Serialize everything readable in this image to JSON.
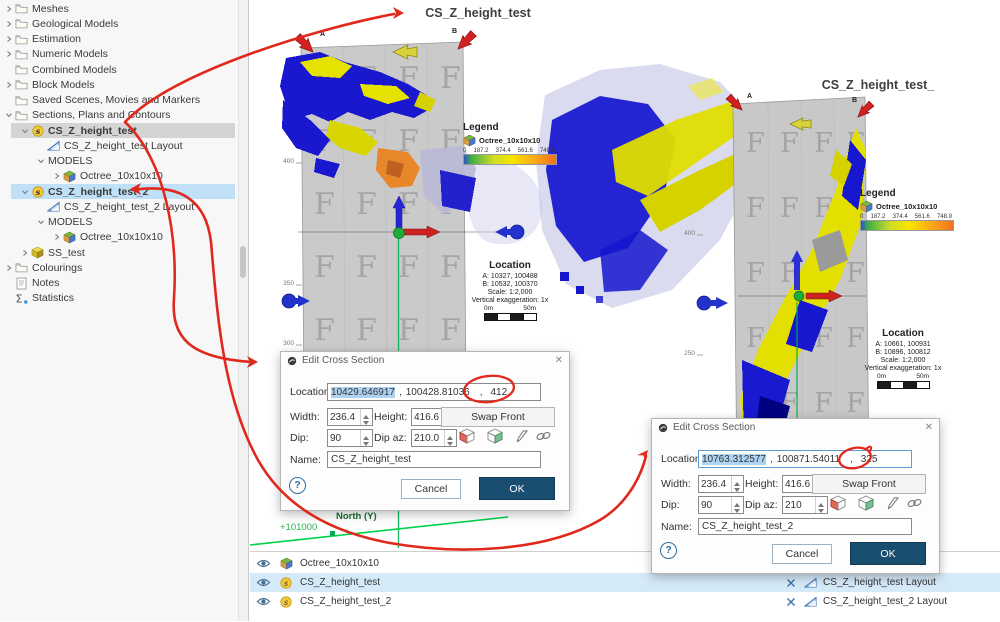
{
  "colors": {
    "accent-blue": "#2d6da3",
    "ok-button": "#1a4e71",
    "selection-blue": "#bfe0f7",
    "selection-gray": "#d4d4d4",
    "row-highlight": "#d5eaf9",
    "text-select": "#aed3f2",
    "annotation-red": "#e0281c",
    "voxel-blue": "#1a18cf",
    "voxel-yellow": "#e6e200",
    "voxel-orange": "#e8872a",
    "plane-gray": "#cacaca",
    "north-green": "#2fae52"
  },
  "sidebar": {
    "items": [
      {
        "label": "Meshes",
        "level": 0,
        "chevron": "collapsed",
        "icon": "folder"
      },
      {
        "label": "Geological Models",
        "level": 0,
        "chevron": "collapsed",
        "icon": "folder"
      },
      {
        "label": "Estimation",
        "level": 0,
        "chevron": "collapsed",
        "icon": "folder"
      },
      {
        "label": "Numeric Models",
        "level": 0,
        "chevron": "collapsed",
        "icon": "folder"
      },
      {
        "label": "Combined Models",
        "level": 0,
        "chevron": "none",
        "icon": "folder"
      },
      {
        "label": "Block Models",
        "level": 0,
        "chevron": "collapsed",
        "icon": "folder"
      },
      {
        "label": "Saved Scenes, Movies and Markers",
        "level": 0,
        "chevron": "none",
        "icon": "folder"
      },
      {
        "label": "Sections, Plans and Contours",
        "level": 0,
        "chevron": "expanded",
        "icon": "folder"
      },
      {
        "label": "CS_Z_height_test",
        "level": 1,
        "chevron": "expanded",
        "icon": "section",
        "bold": true,
        "selected": "gray"
      },
      {
        "label": "CS_Z_height_test Layout",
        "level": 2,
        "chevron": "none",
        "icon": "layout"
      },
      {
        "label": "MODELS",
        "level": 2,
        "chevron": "expanded",
        "icon": "none"
      },
      {
        "label": "Octree_10x10x10",
        "level": 3,
        "chevron": "collapsed",
        "icon": "octree"
      },
      {
        "label": "CS_Z_height_test_2",
        "level": 1,
        "chevron": "expanded",
        "icon": "section",
        "bold": true,
        "selected": "blue"
      },
      {
        "label": "CS_Z_height_test_2 Layout",
        "level": 2,
        "chevron": "none",
        "icon": "layout"
      },
      {
        "label": "MODELS",
        "level": 2,
        "chevron": "expanded",
        "icon": "none"
      },
      {
        "label": "Octree_10x10x10",
        "level": 3,
        "chevron": "collapsed",
        "icon": "octree"
      },
      {
        "label": "SS_test",
        "level": 1,
        "chevron": "collapsed",
        "icon": "cube"
      },
      {
        "label": "Colourings",
        "level": 0,
        "chevron": "collapsed",
        "icon": "folder"
      },
      {
        "label": "Notes",
        "level": 0,
        "chevron": "none",
        "icon": "notes"
      },
      {
        "label": "Statistics",
        "level": 0,
        "chevron": "none",
        "icon": "statistics"
      }
    ]
  },
  "viewport": {
    "left_view": {
      "title": "CS_Z_height_test",
      "marker_a": "A",
      "marker_b": "B",
      "legend": {
        "title": "Legend",
        "layer": "Octree_10x10x10",
        "ticks": [
          "0",
          "187.2",
          "374.4",
          "561.6",
          "748.9"
        ]
      },
      "location": {
        "title": "Location",
        "a_label": "A:",
        "a": "10327, 100488",
        "b_label": "B:",
        "b": "10532, 100370",
        "scale": "Scale: 1:2,000",
        "ve": "Vertical exaggeration: 1x",
        "d0": "0m",
        "d50": "50m"
      },
      "ruler": [
        "400",
        "350",
        "300"
      ]
    },
    "right_view": {
      "title": "CS_Z_height_test_",
      "marker_a": "A",
      "marker_b": "B",
      "legend": {
        "title": "Legend",
        "layer": "Octree_10x10x10",
        "ticks": [
          "0",
          "187.2",
          "374.4",
          "561.6",
          "748.9"
        ]
      },
      "location": {
        "title": "Location",
        "a_label": "A:",
        "a": "10661, 100931",
        "b_label": "B:",
        "b": "10896, 100812",
        "scale": "Scale: 1:2,000",
        "ve": "Vertical exaggeration: 1x",
        "d0": "0m",
        "d50": "50m"
      },
      "ruler": [
        "400",
        "250"
      ]
    },
    "axis": {
      "north": "North (Y)",
      "tick": "+101000"
    }
  },
  "dialog1": {
    "title": "Edit Cross Section",
    "close": "✕",
    "help": "?",
    "loc_label": "Location:",
    "loc_x": "10429.646917",
    "sep": ",",
    "loc_y": "100428.81036",
    "loc_z": "412",
    "width_label": "Width:",
    "width": "236.4",
    "height_label": "Height:",
    "height": "416.6",
    "swap": "Swap Front",
    "dip_label": "Dip:",
    "dip": "90",
    "dipaz_label": "Dip az:",
    "dipaz": "210.0",
    "name_label": "Name:",
    "name": "CS_Z_height_test",
    "cancel": "Cancel",
    "ok": "OK"
  },
  "dialog2": {
    "title": "Edit Cross Section",
    "close": "✕",
    "help": "?",
    "loc_label": "Location:",
    "loc_x": "10763.312577",
    "sep": ",",
    "loc_y": "100871.54011",
    "loc_z": "325",
    "width_label": "Width:",
    "width": "236.4",
    "height_label": "Height:",
    "height": "416.6",
    "swap": "Swap Front",
    "dip_label": "Dip:",
    "dip": "90",
    "dipaz_label": "Dip az:",
    "dipaz": "210",
    "name_label": "Name:",
    "name": "CS_Z_height_test_2",
    "cancel": "Cancel",
    "ok": "OK"
  },
  "bottom_panel": {
    "rows": [
      {
        "icon": "octree",
        "label": "Octree_10x10x10",
        "selected": false,
        "right": null
      },
      {
        "icon": "section",
        "label": "CS_Z_height_test",
        "selected": true,
        "right": {
          "icon": "layout",
          "label": "CS_Z_height_test Layout"
        }
      },
      {
        "icon": "section",
        "label": "CS_Z_height_test_2",
        "selected": false,
        "right": {
          "icon": "layout",
          "label": "CS_Z_height_test_2 Layout"
        }
      }
    ]
  }
}
